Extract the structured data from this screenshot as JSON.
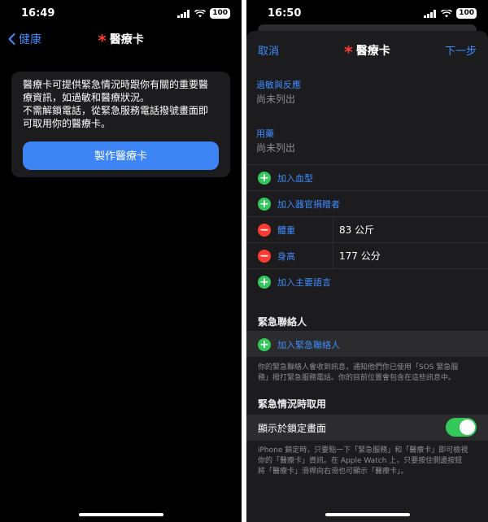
{
  "left": {
    "status": {
      "time": "16:49",
      "battery": "100"
    },
    "nav": {
      "back_label": "健康",
      "title": "醫療卡"
    },
    "intro": {
      "lines": [
        "醫療卡可提供緊急情況時跟你有關的重要醫",
        "療資訊，如過敏和醫療狀況。",
        "不需解鎖電話，從緊急服務電話撥號畫面即",
        "可取用你的醫療卡。"
      ],
      "button_label": "製作醫療卡"
    }
  },
  "right": {
    "status": {
      "time": "16:50",
      "battery": "100"
    },
    "nav": {
      "cancel_label": "取消",
      "title": "醫療卡",
      "next_label": "下一步"
    },
    "allergies": {
      "label": "過敏與反應",
      "value": "尚未列出"
    },
    "medications": {
      "label": "用藥",
      "value": "尚未列出"
    },
    "rows": {
      "add_blood_type": "加入血型",
      "add_organ_donor": "加入器官捐贈者",
      "weight_label": "體重",
      "weight_value": "83 公斤",
      "height_label": "身高",
      "height_value": "177 公分",
      "add_language": "加入主要語言"
    },
    "emergency_contacts": {
      "header": "緊急聯絡人",
      "add_label": "加入緊急聯絡人",
      "footnote_lines": [
        "你的緊急聯絡人會收到訊息，通知他們你已使用「SOS 緊急服",
        "務」撥打緊急服務電話。你的目前位置會包含在這些訊息中。"
      ]
    },
    "emergency_access": {
      "header": "緊急情況時取用",
      "toggle_label": "顯示於鎖定畫面",
      "toggle_on": true,
      "footnote_lines": [
        "iPhone 鎖定時，只要點一下「緊急服務」和「醫療卡」即可檢視",
        "你的「醫療卡」資訊。在 Apple Watch 上，只要按住側邊按鈕",
        "將「醫療卡」滑桿向右滑也可顯示「醫療卡」。"
      ]
    }
  },
  "colors": {
    "accent": "#3f8cff",
    "button": "#3d84f5",
    "asterisk": "#ff3b30",
    "add_icon": "#34c759",
    "remove_icon": "#ff3b30",
    "toggle_on": "#34c759"
  }
}
